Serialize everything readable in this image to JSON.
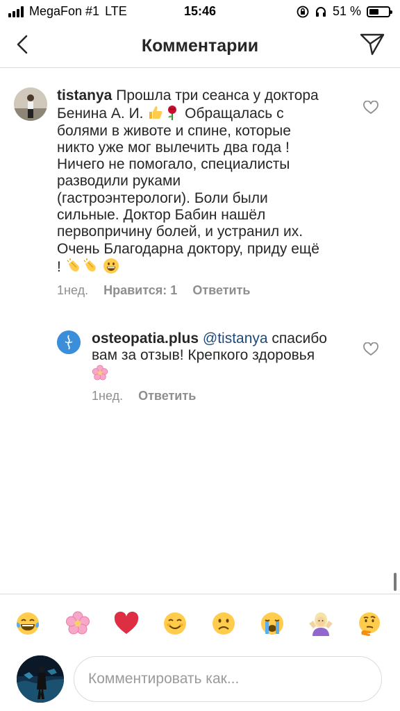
{
  "status_bar": {
    "carrier": "MegaFon #1",
    "network": "LTE",
    "time": "15:46",
    "battery": "51 %",
    "battery_level": 0.51
  },
  "header": {
    "title": "Комментарии",
    "back_icon": "chevron-left-icon",
    "send_icon": "paper-plane-icon"
  },
  "comments": [
    {
      "username": "tistanya",
      "text_lines": [
        "Прошла три сеанса у доктора",
        "Бенина А. И. ",
        "болями в животе и спине, которые",
        "никто уже мог вылечить два года !",
        "Ничего не помогало, специалисты",
        "разводили руками",
        "(гастроэнтерологи). Боли были",
        "сильные. Доктор Бабин нашёл",
        "первопричину болей, и устранил их.",
        "Очень Благодарна доктору, приду ещё",
        "! "
      ],
      "line2_tail": " Обращалась с",
      "time": "1нед.",
      "likes": "Нравится: 1",
      "reply": "Ответить"
    },
    {
      "username": "osteopatia.plus",
      "mention": "@tistanya",
      "text_line1_tail": " спасибо",
      "text_line2": "вам за отзыв! Крепкого здоровья",
      "time": "1нед.",
      "reply": "Ответить"
    }
  ],
  "emoji_bar": [
    "face-with-tears-of-joy",
    "cherry-blossom",
    "red-heart",
    "smiling-face",
    "slightly-frowning-face",
    "loudly-crying-face",
    "person-shrugging",
    "thinking-face"
  ],
  "input": {
    "placeholder": "Комментировать как..."
  },
  "colors": {
    "text": "#262626",
    "secondary": "#8e8e8e",
    "mention": "#1c4a7a",
    "divider": "#dbdbdb",
    "heart_red": "#e0192f"
  }
}
